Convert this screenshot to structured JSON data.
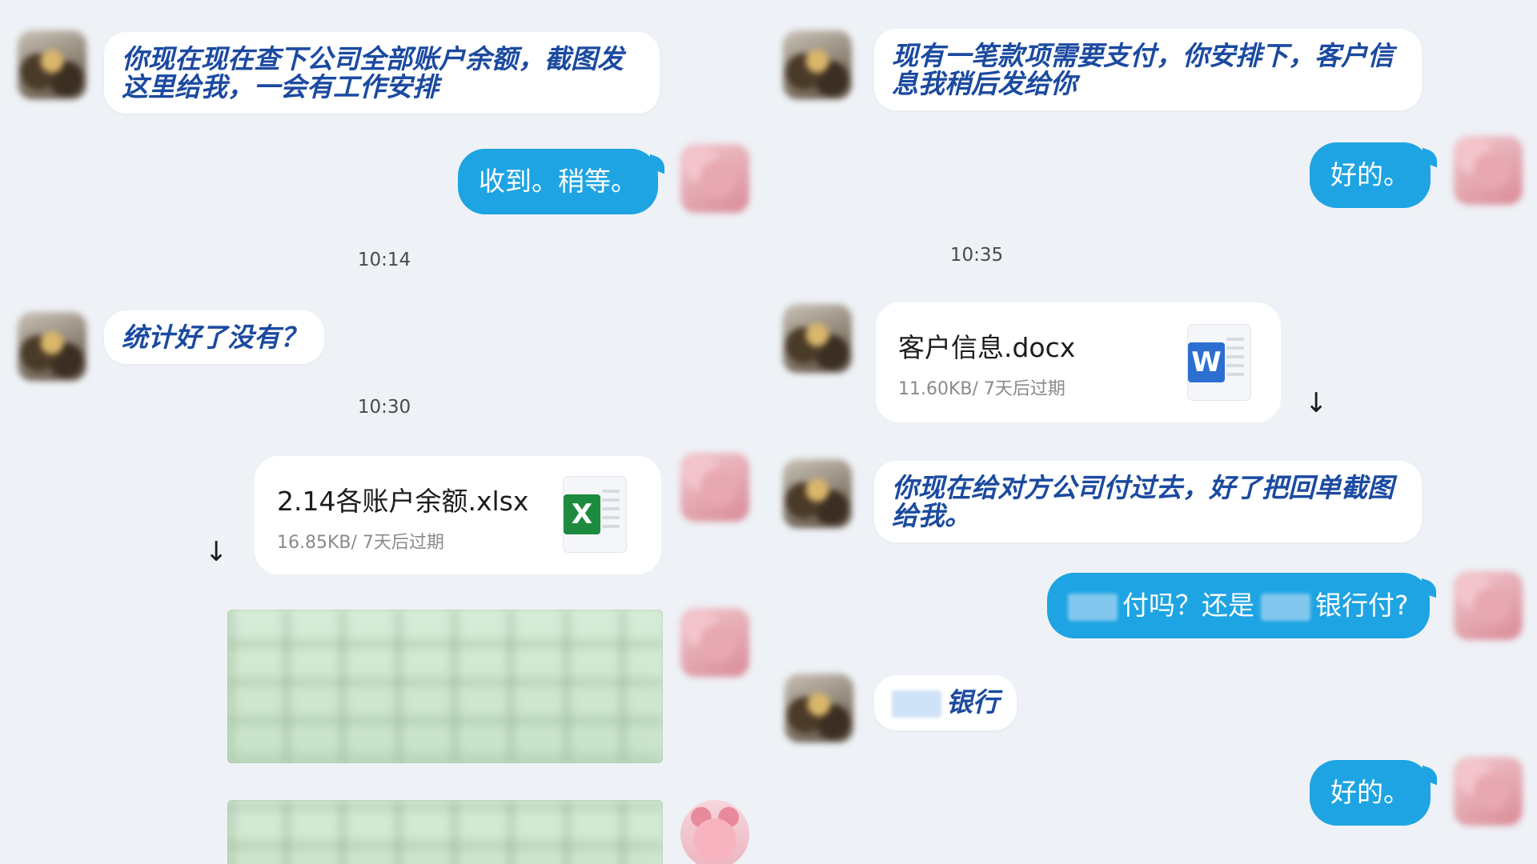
{
  "left": {
    "messages": {
      "m1": "你现在现在查下公司全部账户余额，截图发这里给我，一会有工作安排",
      "m2": "收到。稍等。",
      "time1": "10:14",
      "m3": "统计好了没有？",
      "time2": "10:30",
      "file": {
        "name": "2.14各账户余额.xlsx",
        "meta": "16.85KB/ 7天后过期",
        "icon": "X"
      }
    }
  },
  "right": {
    "messages": {
      "m1": "现有一笔款项需要支付，你安排下，客户信息我稍后发给你",
      "m2": "好的。",
      "time1": "10:35",
      "file": {
        "name": "客户信息.docx",
        "meta": "11.60KB/ 7天后过期",
        "icon": "W"
      },
      "m3": "你现在给对方公司付过去，好了把回单截图给我。",
      "m4a": "付吗？还是",
      "m4b": "银行付?",
      "m5": "银行",
      "m6": "好的。"
    }
  },
  "icons": {
    "download": "↓"
  },
  "colors": {
    "outgoing_bubble": "#1ea4e3",
    "incoming_text": "#1b4aa0",
    "background": "#eef1f6"
  }
}
